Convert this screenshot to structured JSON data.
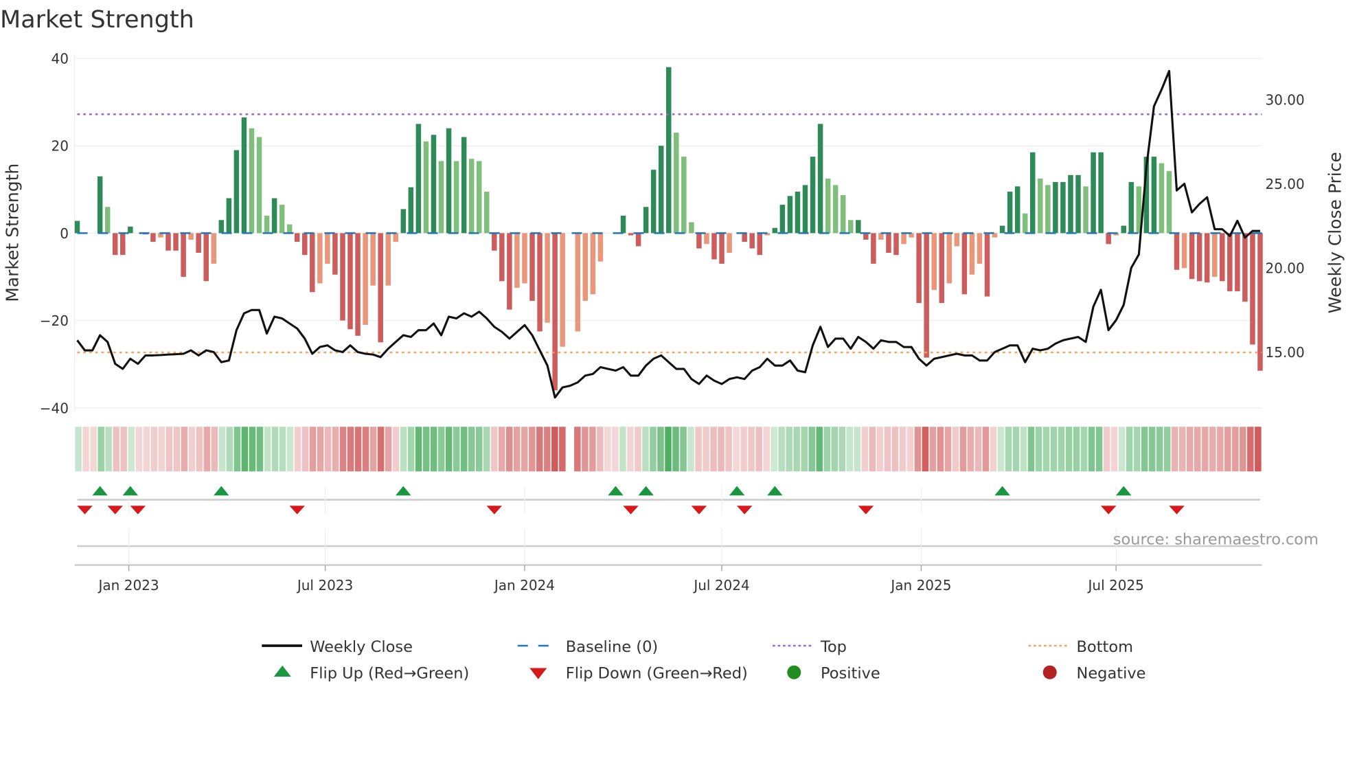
{
  "chart_data": {
    "type": "bar",
    "title": "Market Strength",
    "ylabel": "Market Strength",
    "ylabel_right": "Weekly Close Price",
    "ylim": [
      -40,
      40
    ],
    "ylim_right": [
      11.95,
      32.7
    ],
    "yticks": [
      {
        "v": 40,
        "label": "40"
      },
      {
        "v": 20,
        "label": "20"
      },
      {
        "v": 0,
        "label": "0"
      },
      {
        "v": -20,
        "label": "−20"
      },
      {
        "v": -40,
        "label": "−40"
      }
    ],
    "yticks_right": [
      {
        "v": 30,
        "label": "30.00"
      },
      {
        "v": 25,
        "label": "25.00"
      },
      {
        "v": 20,
        "label": "20.00"
      },
      {
        "v": 15,
        "label": "15.00"
      }
    ],
    "xticks": [
      {
        "i": 6.8,
        "label": "Jan 2023"
      },
      {
        "i": 32.7,
        "label": "Jul 2023"
      },
      {
        "i": 59,
        "label": "Jan 2024"
      },
      {
        "i": 85,
        "label": "Jul 2024"
      },
      {
        "i": 111.3,
        "label": "Jan 2025"
      },
      {
        "i": 137,
        "label": "Jul 2025"
      }
    ],
    "top_level": 27.2,
    "bottom_level": -27.3,
    "baseline": 0,
    "strength": [
      2.8,
      0,
      0,
      13,
      6,
      -5,
      -5,
      1.5,
      0,
      -0.3,
      -2,
      -1,
      -4,
      -4,
      -10,
      -1.5,
      -4.5,
      -11,
      -7,
      3,
      8,
      19,
      26.5,
      24,
      22,
      4,
      8,
      6.5,
      2,
      -2,
      -5,
      -13.5,
      -11.5,
      -7,
      -9.5,
      -20,
      -22,
      -23.5,
      -21,
      -12,
      -25,
      -12,
      -2,
      5.5,
      10.5,
      25,
      21,
      22.5,
      16.5,
      24,
      16.5,
      22,
      17,
      16.5,
      9.5,
      -4,
      -11,
      -17.5,
      -12.5,
      -11.5,
      -15.5,
      -22.5,
      -20.5,
      -36,
      -26,
      null,
      -22.5,
      -15.5,
      -14,
      -6.5,
      0,
      0,
      4,
      -0.5,
      -3,
      6,
      14.5,
      20,
      38,
      23,
      17.5,
      2.5,
      -3.5,
      -2.5,
      -6,
      -7,
      -4.5,
      0,
      -2,
      -3.5,
      -5,
      -0.5,
      1.2,
      6.5,
      8.5,
      9.5,
      11,
      17.5,
      25,
      12.5,
      11,
      8.7,
      3,
      3,
      -1.5,
      -7,
      -1.5,
      -4.5,
      -5,
      -2.5,
      -1,
      -16,
      -28.5,
      -13,
      -16,
      -11.5,
      -3,
      -14,
      -9.5,
      -7,
      -14.5,
      -1,
      1.7,
      9.5,
      10.7,
      4.5,
      18.5,
      12.5,
      11,
      11.7,
      11.7,
      13.3,
      13.3,
      10.7,
      18.5,
      18.5,
      -2.5,
      -0.5,
      1.7,
      11.7,
      10.7,
      17.5,
      17.5,
      16,
      14.2,
      -8.4,
      -8,
      -10.5,
      -11,
      -11.3,
      -10,
      -11,
      -13.3,
      -13.3,
      -15.7,
      -25.5,
      -31.5
    ],
    "weekly_close": [
      15.7,
      15.1,
      15.1,
      16.0,
      15.6,
      14.3,
      14.0,
      14.6,
      14.3,
      14.8,
      14.8,
      14.82,
      14.85,
      14.87,
      14.9,
      15.1,
      14.8,
      15.1,
      15.0,
      14.4,
      14.5,
      16.3,
      17.3,
      17.5,
      17.5,
      16.1,
      17.1,
      17.0,
      16.7,
      16.4,
      15.8,
      14.9,
      15.3,
      15.4,
      15.1,
      15.0,
      15.4,
      15.0,
      14.9,
      14.85,
      14.7,
      15.2,
      15.6,
      16.0,
      15.9,
      16.3,
      16.3,
      16.7,
      16.0,
      17.1,
      17.0,
      17.3,
      17.1,
      17.4,
      17.0,
      16.5,
      16.2,
      15.8,
      16.2,
      16.6,
      16.0,
      15.1,
      14.2,
      12.3,
      12.9,
      13.0,
      13.2,
      13.6,
      13.7,
      14.1,
      14.0,
      13.9,
      14.1,
      13.6,
      13.6,
      14.2,
      14.6,
      14.8,
      14.4,
      14.0,
      14.0,
      13.4,
      13.1,
      13.6,
      13.3,
      13.1,
      13.4,
      13.5,
      13.4,
      13.9,
      14.1,
      14.6,
      14.2,
      14.2,
      14.5,
      13.9,
      13.8,
      15.4,
      16.5,
      15.3,
      15.8,
      15.8,
      15.2,
      15.9,
      15.6,
      15.2,
      15.7,
      15.6,
      15.6,
      15.3,
      15.3,
      14.6,
      14.2,
      14.6,
      14.7,
      14.8,
      14.9,
      14.8,
      14.8,
      14.5,
      14.5,
      15.0,
      15.2,
      15.4,
      15.4,
      14.4,
      15.2,
      15.1,
      15.2,
      15.5,
      15.7,
      15.8,
      15.9,
      15.6,
      17.7,
      18.7,
      16.3,
      16.9,
      17.8,
      20.0,
      20.8,
      26.0,
      29.6,
      30.6,
      31.7,
      24.6,
      25.0,
      23.3,
      23.8,
      24.2,
      22.3,
      22.3,
      21.9,
      22.8,
      21.8,
      22.2,
      22.2
    ],
    "flip_up_weeks": [
      3,
      7,
      19,
      43,
      71,
      75,
      87,
      92,
      122,
      138
    ],
    "flip_down_weeks": [
      1,
      5,
      8,
      29,
      55,
      73,
      82,
      88,
      104,
      136,
      145
    ],
    "legend": [
      {
        "label": "Weekly Close",
        "kind": "line"
      },
      {
        "label": "Baseline (0)",
        "kind": "dash"
      },
      {
        "label": "Top",
        "kind": "dot-top"
      },
      {
        "label": "Bottom",
        "kind": "dot-bottom"
      },
      {
        "label": "Flip Up (Red→Green)",
        "kind": "tri-up"
      },
      {
        "label": "Flip Down (Green→Red)",
        "kind": "tri-down"
      },
      {
        "label": "Positive",
        "kind": "dot-pos"
      },
      {
        "label": "Negative",
        "kind": "dot-neg"
      }
    ],
    "legend_placement": "bottom",
    "source": "source: sharemaestro.com"
  },
  "colors": {
    "up_strong": "#2e8b57",
    "up_weak": "#7fbf7b",
    "down_strong": "#cd5c5c",
    "down_weak": "#e9967a",
    "top": "#9966dd",
    "bottom": "#f4a460",
    "baseline": "#1f77b4",
    "close": "#111111",
    "flip_up": "#1a9641",
    "flip_down": "#d7191c",
    "positive": "#228b22",
    "negative": "#b22222"
  }
}
